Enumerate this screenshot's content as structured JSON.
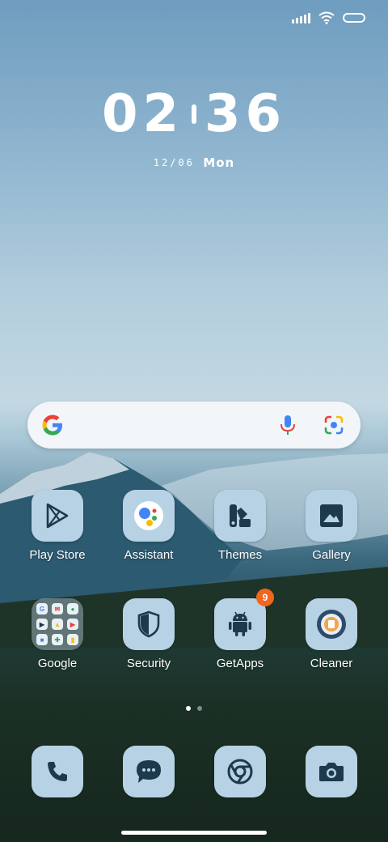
{
  "status_bar": {
    "signal_icon": "cellular-signal-icon",
    "wifi_icon": "wifi-icon",
    "battery_icon": "battery-icon"
  },
  "clock": {
    "hours": "02",
    "minutes": "36"
  },
  "date": {
    "day_month": "12/06",
    "weekday": "Mon"
  },
  "search": {
    "google_icon": "google-g-icon",
    "mic_icon": "microphone-icon",
    "lens_icon": "google-lens-icon"
  },
  "apps_row1": [
    {
      "label": "Play Store",
      "icon": "play-store-icon"
    },
    {
      "label": "Assistant",
      "icon": "assistant-icon"
    },
    {
      "label": "Themes",
      "icon": "themes-icon"
    },
    {
      "label": "Gallery",
      "icon": "gallery-icon"
    }
  ],
  "apps_row2": [
    {
      "label": "Google",
      "icon": "folder-icon"
    },
    {
      "label": "Security",
      "icon": "shield-icon"
    },
    {
      "label": "GetApps",
      "icon": "android-icon",
      "badge": "9"
    },
    {
      "label": "Cleaner",
      "icon": "cleaner-icon"
    }
  ],
  "dock": [
    {
      "icon": "phone-icon"
    },
    {
      "icon": "messages-icon"
    },
    {
      "icon": "chrome-icon"
    },
    {
      "icon": "camera-icon"
    }
  ],
  "page_indicator": {
    "pages": 2,
    "current": 1
  },
  "colors": {
    "tile": "#b6d2e4",
    "icon_dark": "#1d3a4a",
    "badge": "#f0661e"
  }
}
